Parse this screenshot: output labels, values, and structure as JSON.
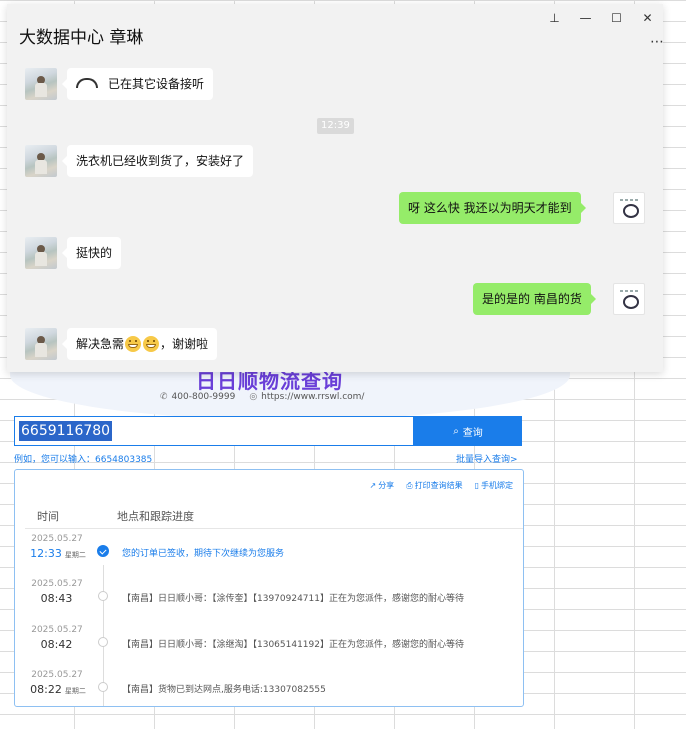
{
  "chat": {
    "title": "大数据中心 章琳",
    "controls": {
      "pin": "⊥",
      "minimize": "—",
      "maximize": "☐",
      "close": "✕"
    },
    "more": "⋯",
    "messages": [
      {
        "side": "in",
        "type": "call",
        "text": "已在其它设备接听"
      },
      {
        "type": "time",
        "text": "12:39"
      },
      {
        "side": "in",
        "text": "洗衣机已经收到货了，安装好了"
      },
      {
        "side": "out",
        "text": "呀  这么快  我还以为明天才能到"
      },
      {
        "side": "in",
        "text": "挺快的"
      },
      {
        "side": "out",
        "text": "是的是的  南昌的货"
      },
      {
        "side": "in",
        "text_before": "解决急需",
        "emoji_count": 2,
        "text_after": "，谢谢啦"
      }
    ]
  },
  "web": {
    "title": "日日顺物流查询",
    "phone": "400-800-9999",
    "website": "https://www.rrswl.com/",
    "search": {
      "value": "6659116780",
      "button": "查询"
    },
    "hint": "例如，您可以输入：6654803385",
    "batch": "批量导入查询>",
    "toolbar": {
      "share": "分享",
      "print": "打印查询结果",
      "bind": "手机绑定"
    },
    "columns": {
      "time": "时间",
      "progress": "地点和跟踪进度"
    },
    "rows": [
      {
        "date": "2025.05.27",
        "time": "12:33",
        "weekday": "星期二",
        "desc": "您的订单已签收，期待下次继续为您服务"
      },
      {
        "date": "2025.05.27",
        "time": "08:43",
        "weekday": "",
        "desc": "【南昌】日日顺小哥：【涂传奎】【13970924711】正在为您派件，感谢您的耐心等待"
      },
      {
        "date": "2025.05.27",
        "time": "08:42",
        "weekday": "",
        "desc": "【南昌】日日顺小哥：【涂继淘】【13065141192】正在为您派件，感谢您的耐心等待"
      },
      {
        "date": "2025.05.27",
        "time": "08:22",
        "weekday": "星期二",
        "desc": "【南昌】货物已到达网点,服务电话:13307082555"
      }
    ]
  }
}
